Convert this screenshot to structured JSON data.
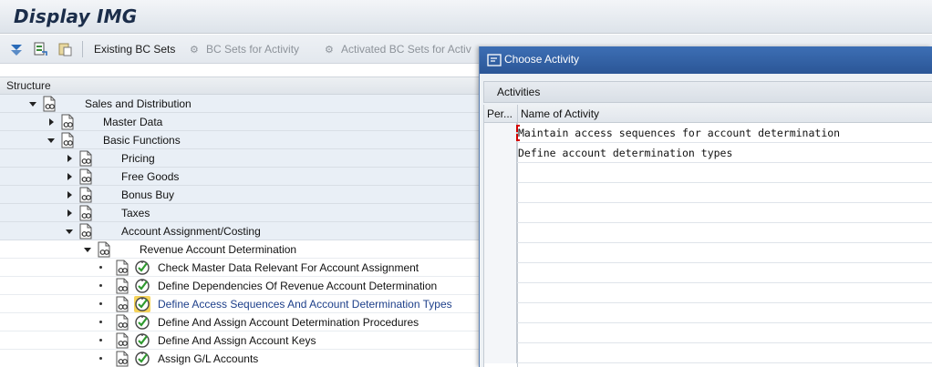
{
  "window": {
    "title": "Display IMG"
  },
  "toolbar": {
    "icons": [
      "expand-icon",
      "where-used-icon",
      "paste-icon"
    ],
    "existing_bc_sets": "Existing BC Sets",
    "bc_sets_for_activity": "BC Sets for Activity",
    "activated_bc_sets": "Activated BC Sets for Activ"
  },
  "tree": {
    "header": "Structure",
    "nodes": [
      {
        "label": "Sales and Distribution",
        "state": "expanded"
      },
      {
        "label": "Master Data",
        "state": "collapsed"
      },
      {
        "label": "Basic Functions",
        "state": "expanded"
      },
      {
        "label": "Pricing",
        "state": "collapsed"
      },
      {
        "label": "Free Goods",
        "state": "collapsed"
      },
      {
        "label": "Bonus Buy",
        "state": "collapsed"
      },
      {
        "label": "Taxes",
        "state": "collapsed"
      },
      {
        "label": "Account Assignment/Costing",
        "state": "expanded"
      },
      {
        "label": "Revenue Account Determination",
        "state": "expanded"
      },
      {
        "label": "Check Master Data Relevant For Account Assignment",
        "state": "leaf"
      },
      {
        "label": "Define Dependencies Of Revenue Account Determination",
        "state": "leaf"
      },
      {
        "label": "Define Access Sequences And Account Determination Types",
        "state": "leaf-selected"
      },
      {
        "label": "Define And Assign Account Determination Procedures",
        "state": "leaf"
      },
      {
        "label": "Define And Assign Account Keys",
        "state": "leaf"
      },
      {
        "label": "Assign G/L Accounts",
        "state": "leaf"
      }
    ]
  },
  "dialog": {
    "title": "Choose Activity",
    "tab": "Activities",
    "columns": [
      "Per...",
      "Name of Activity"
    ],
    "rows": [
      {
        "per": "",
        "name": "Maintain access sequences for account determination"
      },
      {
        "per": "",
        "name": "Define account determination types"
      }
    ]
  },
  "colors": {
    "dialog_title_bg": "#2b5697",
    "selected_link": "#1d3f8a",
    "highlight": "#f5d35a"
  }
}
